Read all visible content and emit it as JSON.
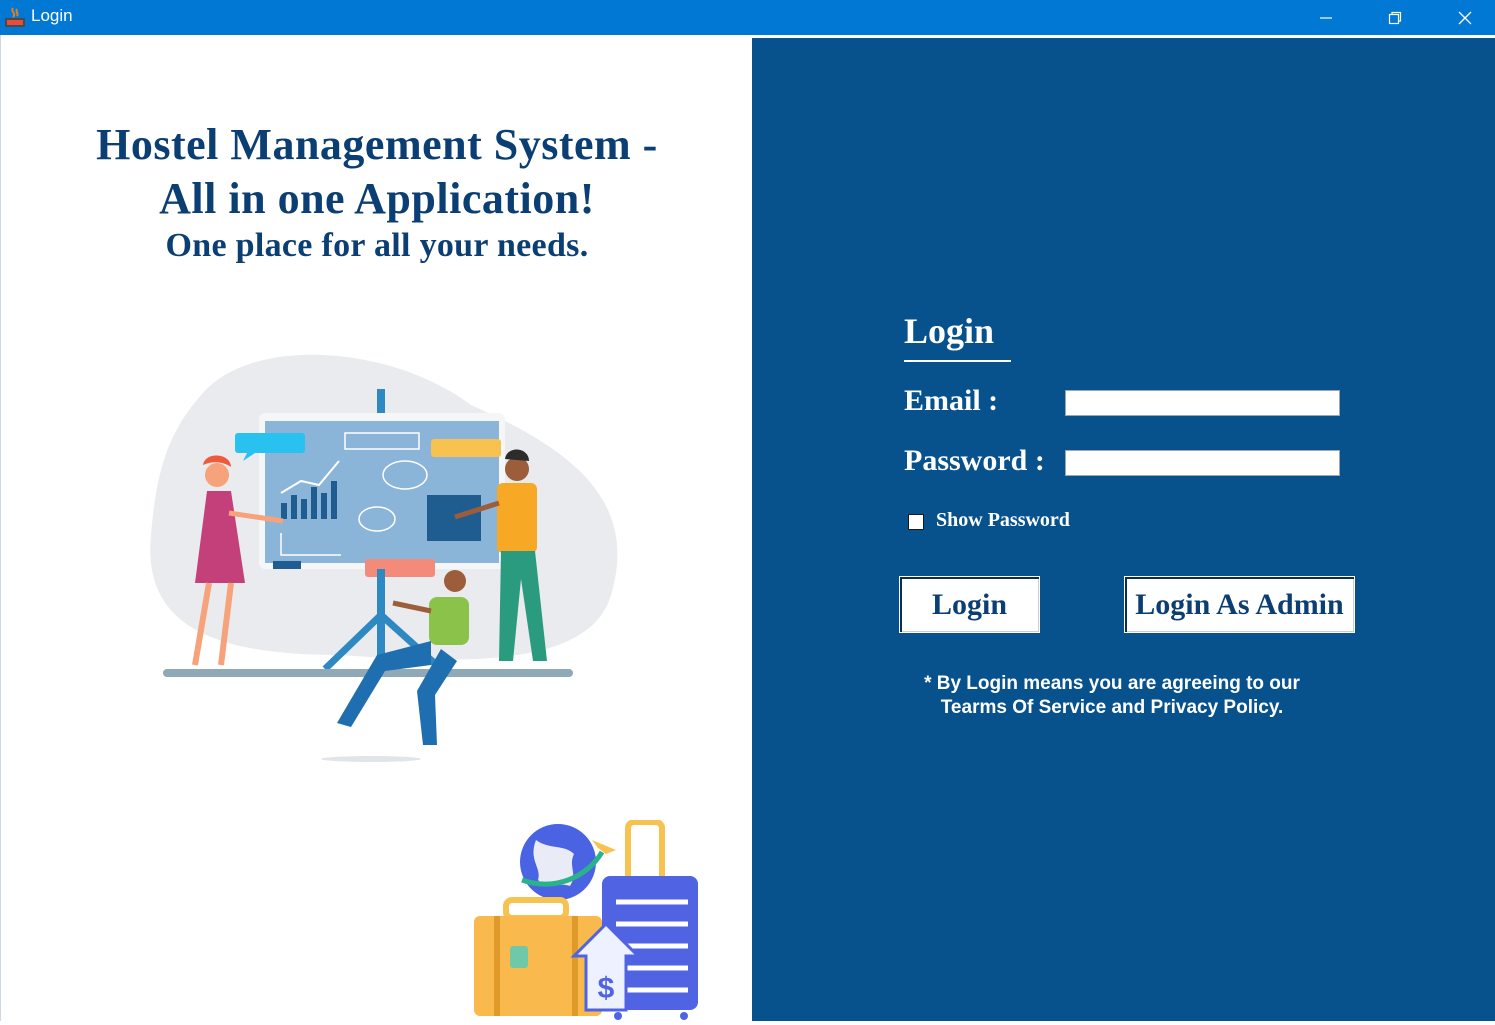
{
  "window": {
    "title": "Login",
    "controls": [
      "minimize-icon",
      "restore-icon",
      "close-icon"
    ]
  },
  "left": {
    "headline_line1": "Hostel Management System -",
    "headline_line2": "All in one Application!",
    "tagline": "One place for all your needs.",
    "illustration_icon": "team-presentation-illustration",
    "luggage_icon": "travel-luggage-illustration"
  },
  "form": {
    "heading": "Login",
    "email_label": "Email :",
    "email_value": "",
    "password_label": "Password :",
    "password_value": "",
    "show_password_label": "Show Password",
    "show_password_checked": false,
    "login_button": "Login",
    "admin_button": "Login As Admin",
    "notice_line1": "* By Login means you are agreeing to our",
    "notice_line2": "Tearms Of Service and Privacy Policy."
  },
  "colors": {
    "titlebar": "#0178d4",
    "panel": "#07518d",
    "headline": "#0b3f73"
  }
}
